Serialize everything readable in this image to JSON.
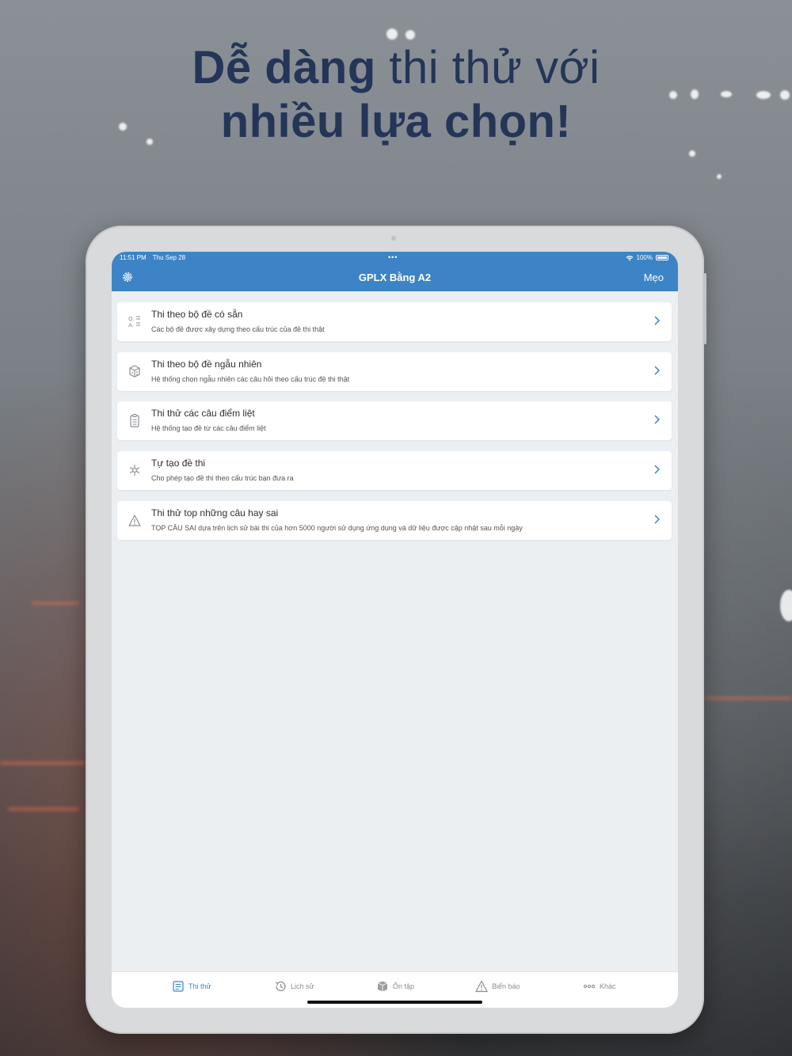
{
  "headline": {
    "line1_bold": "Dễ dàng",
    "line1_rest": "thi thử với",
    "line2": "nhiều lựa chọn!"
  },
  "status_bar": {
    "time": "11:51 PM",
    "date": "Thu Sep 28",
    "battery": "100%"
  },
  "navbar": {
    "title": "GPLX Bằng A2",
    "right_label": "Mẹo",
    "left_icon": "gear-icon"
  },
  "menu": {
    "items": [
      {
        "title": "Thi theo bộ đề có sẵn",
        "subtitle": "Các bộ đề được xây dựng theo cấu trúc của đề thi thật",
        "icon": "qa-list-icon"
      },
      {
        "title": "Thi theo bộ đề ngẫu nhiên",
        "subtitle": "Hệ thống chọn ngẫu nhiên các câu hỏi theo cấu trúc đề thi thật",
        "icon": "cube-icon"
      },
      {
        "title": "Thi thử các câu điểm liệt",
        "subtitle": "Hệ thống tạo đề từ các câu điểm liệt",
        "icon": "clipboard-icon"
      },
      {
        "title": "Tự tạo đề thi",
        "subtitle": "Cho phép tạo đề thi theo cấu trúc bạn đưa ra",
        "icon": "snowflake-gear-icon"
      },
      {
        "title": "Thi thử top những câu hay sai",
        "subtitle": "TOP CÂU SAI dựa trên lịch sử bài thi của hơn 5000 người sử dụng ứng dụng và dữ liệu được cập nhật sau mỗi ngày",
        "icon": "warning-icon"
      }
    ]
  },
  "tabs": [
    {
      "label": "Thi thử",
      "icon": "exam-icon",
      "active": true
    },
    {
      "label": "Lịch sử",
      "icon": "history-icon",
      "active": false
    },
    {
      "label": "Ôn tập",
      "icon": "box-icon",
      "active": false
    },
    {
      "label": "Biển báo",
      "icon": "warning-icon",
      "active": false
    },
    {
      "label": "Khác",
      "icon": "more-icon",
      "active": false
    }
  ],
  "colors": {
    "accent": "#3d84c6",
    "headline": "#243558",
    "screen_bg": "#eceff2"
  }
}
